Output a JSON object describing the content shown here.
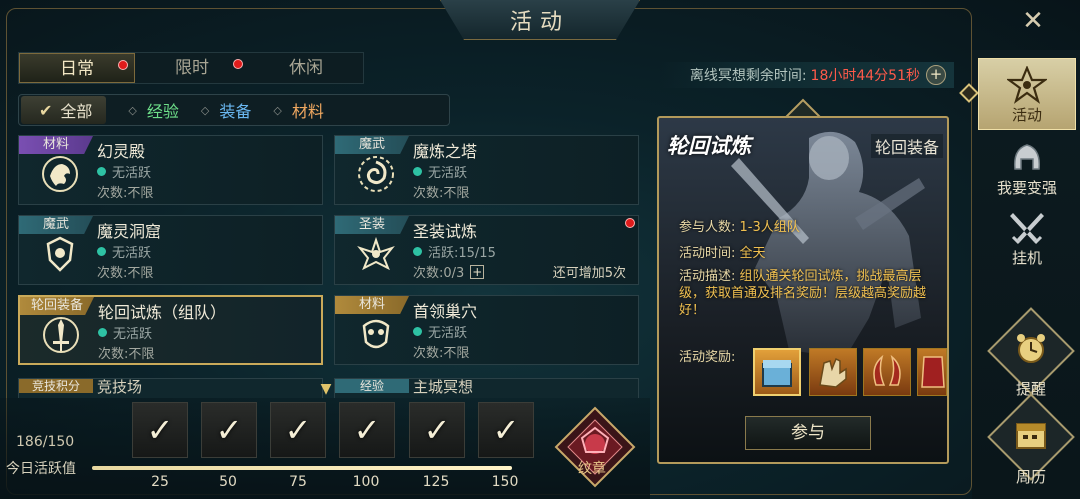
{
  "title": "活动",
  "tabs": [
    {
      "label": "日常",
      "active": true,
      "dot": true
    },
    {
      "label": "限时",
      "active": false,
      "dot": true
    },
    {
      "label": "休闲",
      "active": false,
      "dot": false
    }
  ],
  "filters": [
    {
      "label": "全部",
      "color": "#e8e2cc"
    },
    {
      "label": "经验",
      "color": "#6ee08a"
    },
    {
      "label": "装备",
      "color": "#6ab7f0"
    },
    {
      "label": "材料",
      "color": "#f0a860"
    }
  ],
  "cards": [
    {
      "tag": "材料",
      "tag_style": "purple",
      "name": "幻灵殿",
      "status": "无活跃",
      "count": "次数:不限",
      "extra": "",
      "dot": false,
      "selected": false,
      "emblem": "lion-emblem-icon"
    },
    {
      "tag": "魔武",
      "tag_style": "teal",
      "name": "魔炼之塔",
      "status": "无活跃",
      "count": "次数:不限",
      "extra": "",
      "dot": false,
      "selected": false,
      "emblem": "swirl-emblem-icon"
    },
    {
      "tag": "魔武",
      "tag_style": "teal",
      "name": "魔灵洞窟",
      "status": "无活跃",
      "count": "次数:不限",
      "extra": "",
      "dot": false,
      "selected": false,
      "emblem": "shield-emblem-icon"
    },
    {
      "tag": "圣装",
      "tag_style": "teal",
      "name": "圣装试炼",
      "status": "活跃:15/15",
      "count": "次数:0/3",
      "extra": "还可增加5次",
      "dot": true,
      "selected": false,
      "emblem": "wing-emblem-icon",
      "plus": true
    },
    {
      "tag": "轮回装备",
      "tag_style": "gold",
      "name": "轮回试炼（组队）",
      "status": "无活跃",
      "count": "次数:不限",
      "extra": "",
      "dot": false,
      "selected": true,
      "emblem": "sword-emblem-icon"
    },
    {
      "tag": "材料",
      "tag_style": "gold",
      "name": "首领巢穴",
      "status": "无活跃",
      "count": "次数:不限",
      "extra": "",
      "dot": false,
      "selected": false,
      "emblem": "mask-emblem-icon"
    }
  ],
  "partial_cards": [
    {
      "tag": "竞技积分",
      "name": "竞技场"
    },
    {
      "tag": "经验",
      "name": "主城冥想"
    }
  ],
  "activity": {
    "value": "186/150",
    "label": "今日活跃值",
    "progress_fraction": 1.0,
    "milestones": [
      "25",
      "50",
      "75",
      "100",
      "125",
      "150"
    ]
  },
  "badge": {
    "label": "纹章"
  },
  "timer": {
    "label": "离线冥想剩余时间:",
    "value": "18小时44分51秒"
  },
  "detail": {
    "title": "轮回试炼",
    "reward_tag": "轮回装备",
    "participants_label": "参与人数:",
    "participants_value": "1-3人组队",
    "time_label": "活动时间:",
    "time_value": "全天",
    "desc_label": "活动描述:",
    "desc_value": "组队通关轮回试炼，挑战最高层级，获取首通及排名奖励！层级越高奖励越好！",
    "reward_label": "活动奖励:",
    "join_label": "参与"
  },
  "sidebar": [
    {
      "label": "活动",
      "active": true,
      "icon": "star-emblem-icon"
    },
    {
      "label": "我要变强",
      "active": false,
      "icon": "helmet-icon"
    },
    {
      "label": "挂机",
      "active": false,
      "icon": "crossed-swords-icon"
    }
  ],
  "sidebar_round": [
    {
      "label": "提醒",
      "icon": "alarm-clock-icon"
    },
    {
      "label": "周历",
      "icon": "calendar-icon"
    }
  ]
}
